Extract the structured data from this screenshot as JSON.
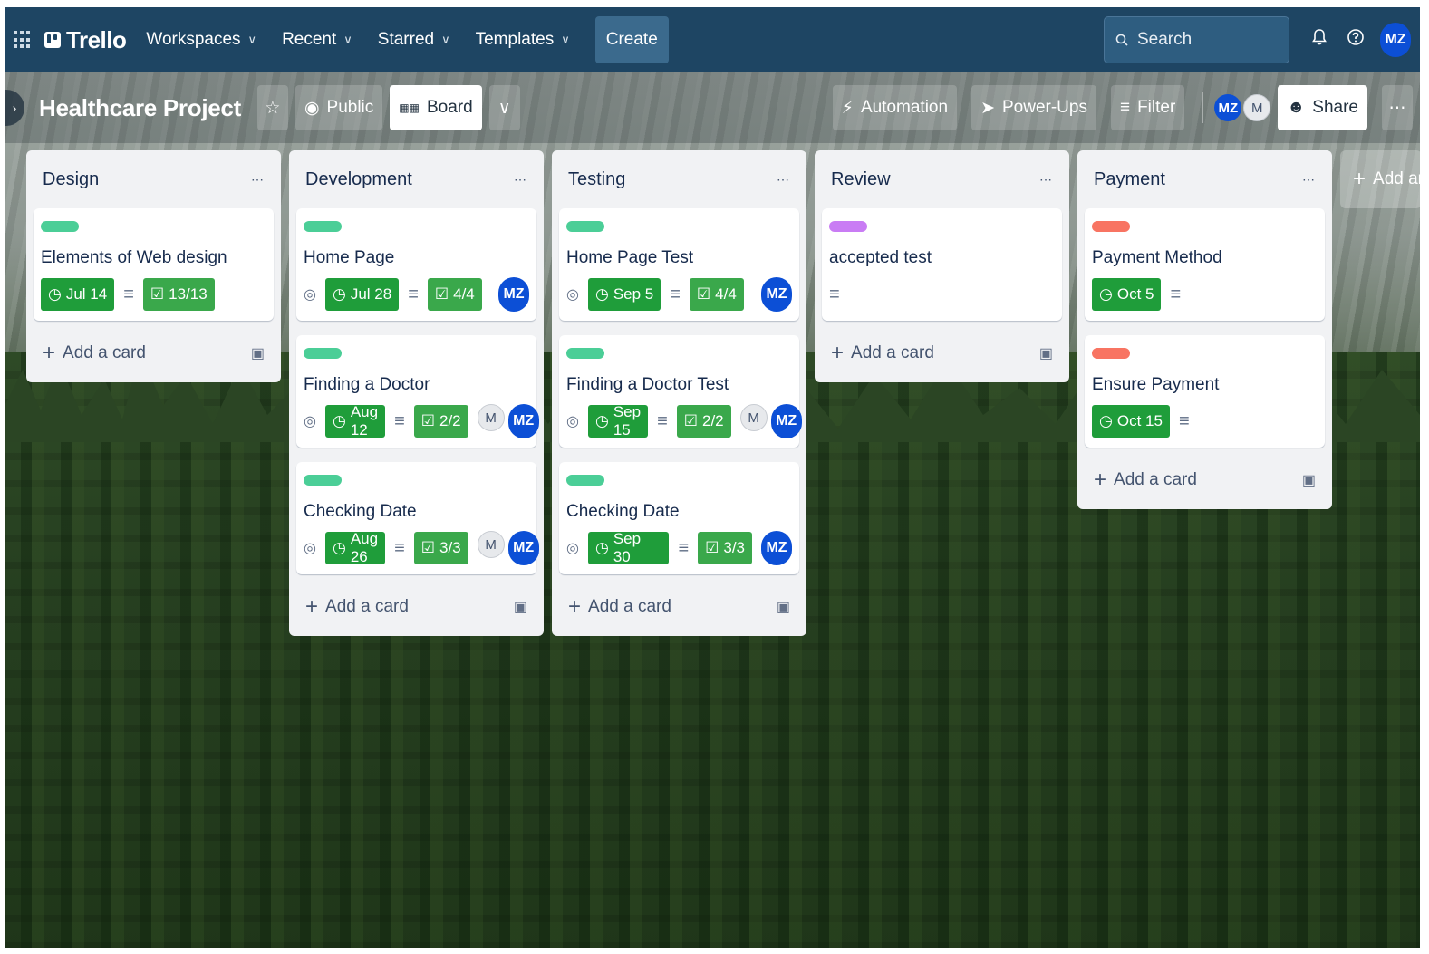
{
  "topnav": {
    "logo": "Trello",
    "items": [
      {
        "label": "Workspaces"
      },
      {
        "label": "Recent"
      },
      {
        "label": "Starred"
      },
      {
        "label": "Templates"
      }
    ],
    "create_label": "Create",
    "search_placeholder": "Search",
    "user_initials": "MZ"
  },
  "board": {
    "title": "Healthcare Project",
    "visibility": "Public",
    "view": "Board",
    "automation": "Automation",
    "powerups": "Power-Ups",
    "filter": "Filter",
    "members": [
      "MZ",
      "M"
    ],
    "share": "Share"
  },
  "lists": [
    {
      "title": "Design",
      "add_card": "Add a card",
      "cards": [
        {
          "label_color": "#4bce97",
          "title": "Elements of Web design",
          "watch": false,
          "due": "Jul 14",
          "description": true,
          "checklist": "13/13",
          "members": []
        }
      ]
    },
    {
      "title": "Development",
      "add_card": "Add a card",
      "cards": [
        {
          "label_color": "#4bce97",
          "title": "Home Page",
          "watch": true,
          "due": "Jul 28",
          "description": true,
          "checklist": "4/4",
          "members": [
            "MZ"
          ]
        },
        {
          "label_color": "#4bce97",
          "title": "Finding a Doctor",
          "watch": true,
          "due": "Aug 12",
          "description": true,
          "checklist": "2/2",
          "members": [
            "M",
            "MZ"
          ]
        },
        {
          "label_color": "#4bce97",
          "title": "Checking Date",
          "watch": true,
          "due": "Aug 26",
          "description": true,
          "checklist": "3/3",
          "members": [
            "M",
            "MZ"
          ]
        }
      ]
    },
    {
      "title": "Testing",
      "add_card": "Add a card",
      "cards": [
        {
          "label_color": "#4bce97",
          "title": "Home Page Test",
          "watch": true,
          "due": "Sep 5",
          "description": true,
          "checklist": "4/4",
          "members": [
            "MZ"
          ]
        },
        {
          "label_color": "#4bce97",
          "title": "Finding a Doctor Test",
          "watch": true,
          "due": "Sep 15",
          "description": true,
          "checklist": "2/2",
          "members": [
            "M",
            "MZ"
          ]
        },
        {
          "label_color": "#4bce97",
          "title": "Checking Date",
          "watch": true,
          "due": "Sep 30",
          "description": true,
          "checklist": "3/3",
          "members": [
            "MZ"
          ]
        }
      ]
    },
    {
      "title": "Review",
      "add_card": "Add a card",
      "cards": [
        {
          "label_color": "#c97cf4",
          "title": "accepted test",
          "watch": false,
          "due": null,
          "description": true,
          "checklist": null,
          "members": []
        }
      ]
    },
    {
      "title": "Payment",
      "add_card": "Add a card",
      "cards": [
        {
          "label_color": "#f87462",
          "title": "Payment Method",
          "watch": false,
          "due": "Oct 5",
          "description": true,
          "checklist": null,
          "members": []
        },
        {
          "label_color": "#f87462",
          "title": "Ensure Payment",
          "watch": false,
          "due": "Oct 15",
          "description": true,
          "checklist": null,
          "members": []
        }
      ]
    }
  ],
  "add_another_list": "Add another list"
}
